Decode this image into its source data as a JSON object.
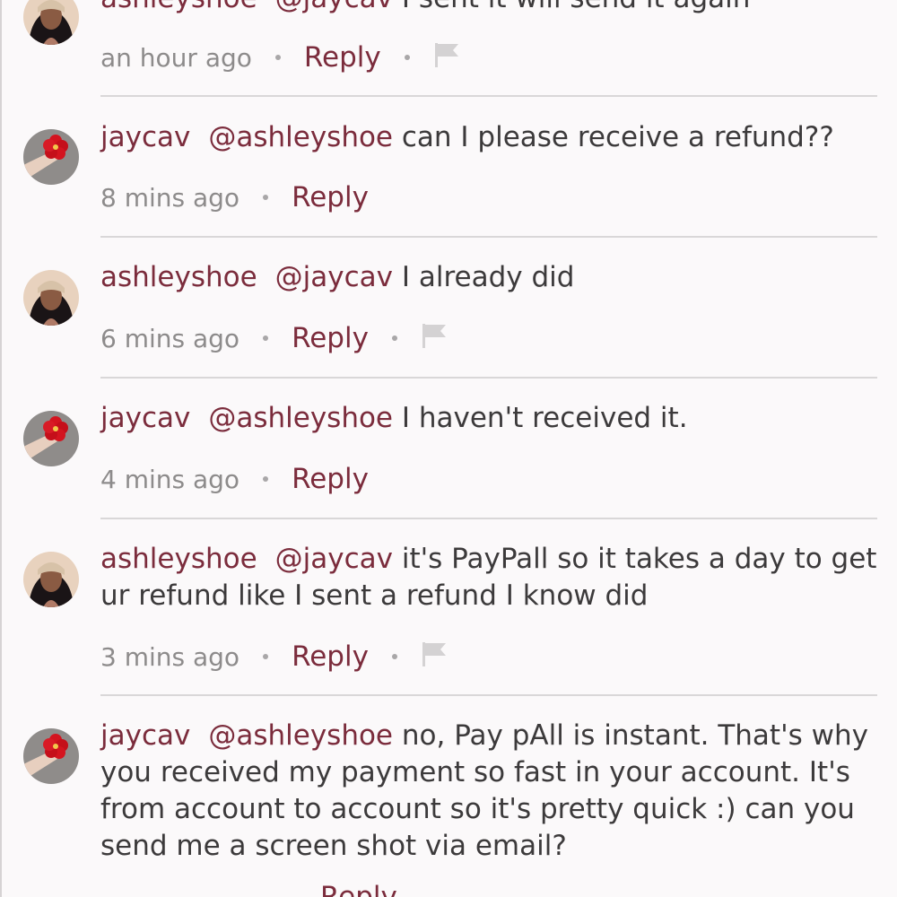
{
  "comments": [
    {
      "user": "ashleyshoe",
      "mention": "@jaycav",
      "text": "I sent it will send it again",
      "time": "an hour ago",
      "reply": "Reply"
    },
    {
      "user": "jaycav",
      "mention": "@ashleyshoe",
      "text": "can I please receive a refund??",
      "time": "8 mins ago",
      "reply": "Reply"
    },
    {
      "user": "ashleyshoe",
      "mention": "@jaycav",
      "text": "I already did",
      "time": "6 mins ago",
      "reply": "Reply"
    },
    {
      "user": "jaycav",
      "mention": "@ashleyshoe",
      "text": "I haven't received it.",
      "time": "4 mins ago",
      "reply": "Reply"
    },
    {
      "user": "ashleyshoe",
      "mention": "@jaycav",
      "text": "it's PayPall so it takes a day to get ur refund like I sent a refund I know did",
      "time": "3 mins ago",
      "reply": "Reply"
    },
    {
      "user": "jaycav",
      "mention": "@ashleyshoe",
      "text": "no, Pay pAll is instant. That's why you received my payment so fast in your account. It's from account to account so it's pretty quick :) can you send me a screen shot via email?",
      "time": "",
      "reply": "Reply"
    }
  ],
  "icons": {
    "flag": "flag-icon",
    "avatar_ashley": "avatar-photo",
    "avatar_jaycav": "red-flower-photo"
  },
  "colors": {
    "username": "#7b2c3c",
    "text": "#3c3a3b",
    "meta": "#8d8b8b",
    "background": "#fbf9fa"
  }
}
